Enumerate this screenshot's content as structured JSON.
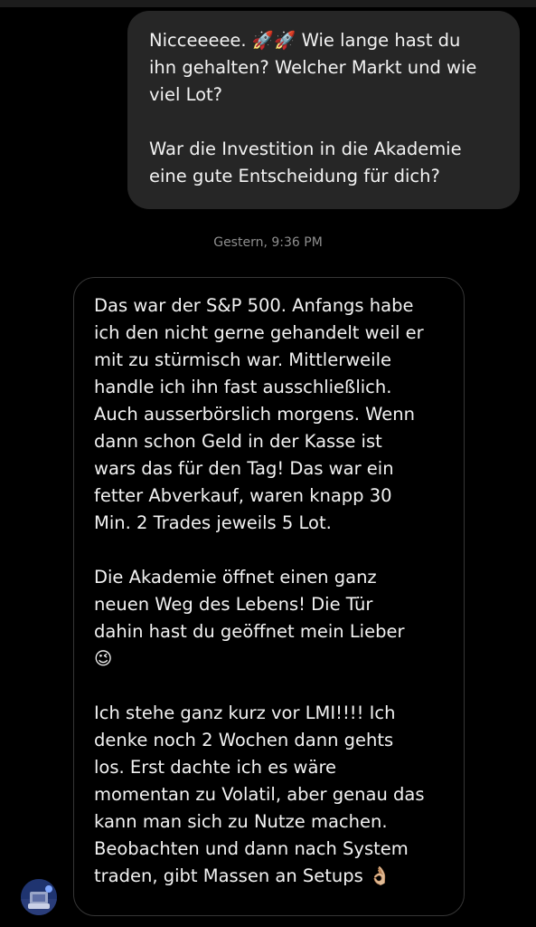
{
  "thread": {
    "sent_message": {
      "line1_pre": "Nicceeeee. ",
      "line1_emoji": "🚀🚀",
      "line1_post": " Wie lange hast du\nihn gehalten? Welcher Markt und wie\nviel Lot?",
      "paragraph2": "War die Investition in die Akademie\neine gute Entscheidung für dich?"
    },
    "timestamp": "Gestern, 9:36 PM",
    "received_message": {
      "paragraph1": "Das war der S&P 500. Anfangs habe\nich den nicht gerne gehandelt weil er\nmit zu stürmisch war. Mittlerweile\nhandle ich ihn fast ausschließlich.\nAuch ausserbörslich morgens. Wenn\ndann schon Geld in der Kasse ist\nwars das für den Tag! Das war ein\nfetter Abverkauf, waren knapp 30\nMin. 2 Trades jeweils 5 Lot.",
      "paragraph2": "Die Akademie öffnet einen ganz\nneuen Weg des Lebens! Die Tür\ndahin hast du geöffnet mein Lieber",
      "paragraph2_emoji": "😉",
      "paragraph3": "Ich stehe ganz kurz vor LMI!!!! Ich\ndenke noch 2 Wochen dann gehts\nlos. Erst dachte ich es wäre\nmomentan zu Volatil, aber genau das\nkann man sich zu Nutze machen.\nBeobachten und dann nach System\ntraden, gibt Massen an Setups",
      "paragraph3_emoji": "👌🏼"
    },
    "avatar_icon": "user-avatar-icon"
  },
  "colors": {
    "background": "#000000",
    "sent_bubble": "#262626",
    "received_border": "#363636",
    "timestamp": "#8e8e8e",
    "text": "#f2f2f2"
  }
}
